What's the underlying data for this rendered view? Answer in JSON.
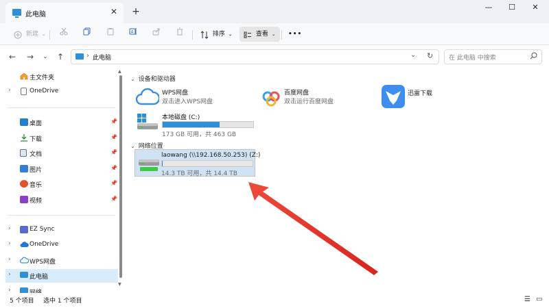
{
  "window": {
    "tab_title": "此电脑",
    "tab_close": "✕",
    "tab_add": "+",
    "minimize": "—",
    "maximize": "☐",
    "close": "✕"
  },
  "toolbar": {
    "new_label": "新建",
    "sort_label": "排序",
    "view_label": "查看",
    "more_label": "•••"
  },
  "address": {
    "path": "此电脑",
    "search_placeholder": "在 此电脑 中搜索"
  },
  "sidebar": {
    "home": "主文件夹",
    "onedrive_top": "OneDrive",
    "quick": [
      {
        "label": "桌面",
        "color": "#1f7fd0"
      },
      {
        "label": "下载",
        "color": "#2a8a3a"
      },
      {
        "label": "文档",
        "color": "#5a6f8f"
      },
      {
        "label": "图片",
        "color": "#2f7fd8"
      },
      {
        "label": "音乐",
        "color": "#e0532f"
      },
      {
        "label": "视频",
        "color": "#8a3fc8"
      }
    ],
    "bottom": [
      {
        "label": "EZ Sync",
        "color": "#5b6ad0"
      },
      {
        "label": "OneDrive",
        "color": "#1d78d6"
      },
      {
        "label": "WPS网盘",
        "color": "#3a8ee6"
      },
      {
        "label": "此电脑",
        "color": "#2f8fd8"
      },
      {
        "label": "网络",
        "color": "#2f8fd8"
      }
    ]
  },
  "content": {
    "group_devices": "设备和驱动器",
    "group_network": "网络位置",
    "wps": {
      "name": "WPS网盘",
      "sub": "双击进入WPS网盘"
    },
    "baidu": {
      "name": "百度网盘",
      "sub": "双击运行百度网盘"
    },
    "xunlei": {
      "name": "迅雷下载"
    },
    "local_disk": {
      "name": "本地磁盘 (C:)",
      "sub": "173 GB 可用，共 463 GB",
      "used_fraction": 0.63
    },
    "net_drive": {
      "name": "laowang (\\\\192.168.50.253) (Z:)",
      "sub": "14.3 TB 可用，共 14.4 TB",
      "used_fraction": 0.01
    }
  },
  "status": {
    "count": "5 个项目",
    "selected": "选中 1 个项目"
  },
  "colors": {
    "accent": "#2d8ed8",
    "selection": "#cfe3f4",
    "arrow": "#e8332b"
  }
}
